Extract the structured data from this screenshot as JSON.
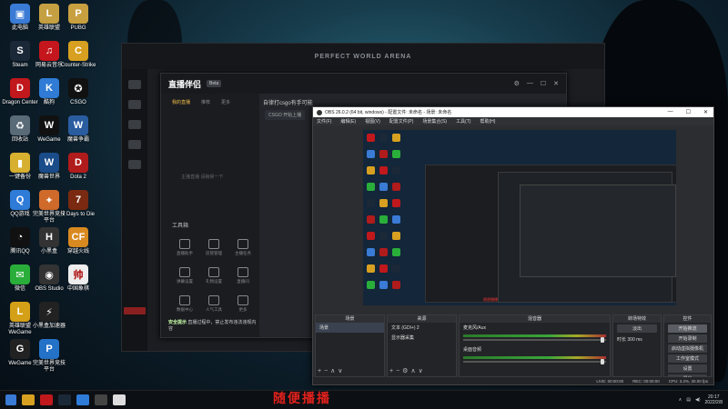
{
  "desktop_icons": [
    {
      "label": "此电脑",
      "color": "#3a7bd5",
      "glyph": "▣"
    },
    {
      "label": "Steam",
      "color": "#1b2838",
      "glyph": "S"
    },
    {
      "label": "Dragon Center",
      "color": "#c0181c",
      "glyph": "D"
    },
    {
      "label": "回收站",
      "color": "#5a6b78",
      "glyph": "♻"
    },
    {
      "label": "一键备份",
      "color": "#d8b030",
      "glyph": "▮"
    },
    {
      "label": "QQ游戏",
      "color": "#2e7bd8",
      "glyph": "Q"
    },
    {
      "label": "腾讯QQ",
      "color": "#111",
      "glyph": "◔"
    },
    {
      "label": "微信",
      "color": "#2aae3a",
      "glyph": "✉"
    },
    {
      "label": "英雄联盟 WeGame",
      "color": "#d4a017",
      "glyph": "L"
    },
    {
      "label": "WeGame",
      "color": "#222",
      "glyph": "G"
    },
    {
      "label": "英雄联盟",
      "color": "#c5a042",
      "glyph": "L"
    },
    {
      "label": "网易云音乐",
      "color": "#c4161c",
      "glyph": "♫"
    },
    {
      "label": "酷狗",
      "color": "#2f7bd6",
      "glyph": "K"
    },
    {
      "label": "WeGame",
      "color": "#111",
      "glyph": "W"
    },
    {
      "label": "魔兽世界",
      "color": "#1a4c8a",
      "glyph": "W"
    },
    {
      "label": "完美世界竞技平台",
      "color": "#d06a2a",
      "glyph": "✦"
    },
    {
      "label": "小黑盒",
      "color": "#333",
      "glyph": "H"
    },
    {
      "label": "OBS Studio",
      "color": "#333",
      "glyph": "◉"
    },
    {
      "label": "小黑盒加速器",
      "color": "#222",
      "glyph": "⚡"
    },
    {
      "label": "完美世界竞技平台",
      "color": "#2471c8",
      "glyph": "P"
    },
    {
      "label": "PUBG",
      "color": "#c8a040",
      "glyph": "P"
    },
    {
      "label": "Counter-Strike",
      "color": "#d8a020",
      "glyph": "C"
    },
    {
      "label": "CSGO",
      "color": "#111",
      "glyph": "✪"
    },
    {
      "label": "魔兽争霸",
      "color": "#2a5ca0",
      "glyph": "W"
    },
    {
      "label": "Dota 2",
      "color": "#b01b1b",
      "glyph": "D"
    },
    {
      "label": "7 Days to Die",
      "color": "#7a2a10",
      "glyph": "7"
    },
    {
      "label": "穿越火线",
      "color": "#d88a20",
      "glyph": "CF"
    },
    {
      "label": "中国象棋",
      "color": "#eee",
      "glyph": "帅"
    }
  ],
  "client": {
    "brand": "PERFECT WORLD ARENA"
  },
  "companion": {
    "logo": "直播伴侣",
    "version": "Beta",
    "tabs": [
      "我的直播",
      "推荐",
      "更多"
    ],
    "game_title": "自律打csgo有手可能",
    "category": "CSGO",
    "category_btn": "开始上播",
    "center_text": "主播直播 请稍候一下",
    "toolbox": "工具箱",
    "tools": [
      "直播助手",
      "房管管理",
      "主播任务",
      "弹幕设置",
      "礼物设置",
      "直播间",
      "数据中心",
      "人气工具",
      "更多"
    ],
    "notice_prefix": "安全提示",
    "notice": "直播过程中，禁止发布违法违规内容"
  },
  "obs": {
    "title": "OBS 26.0.2 (64 bit, windows) - 配置文件: 未命名 - 场景: 未命名",
    "menu": [
      "文件(F)",
      "编辑(E)",
      "视图(V)",
      "配置文件(P)",
      "场景集合(S)",
      "工具(T)",
      "帮助(H)"
    ],
    "preview_label": "随便播播",
    "docks": {
      "scenes": {
        "header": "场景",
        "items": [
          "场景"
        ]
      },
      "sources": {
        "header": "来源",
        "items": [
          "文本 (GDI+) 2",
          "显示器采集"
        ]
      },
      "mixer": {
        "header": "混音器",
        "channels": [
          {
            "name": "麦克风/Aux",
            "level": "0.0 dB"
          },
          {
            "name": "桌面音频",
            "level": "0.0 dB"
          }
        ]
      },
      "transitions": {
        "header": "转场特效",
        "type": "淡出",
        "duration_label": "时长",
        "duration": "300 ms"
      },
      "controls": {
        "header": "控件",
        "buttons": [
          "开始推流",
          "开始录制",
          "启动虚拟摄像机",
          "工作室模式",
          "设置",
          "退出"
        ]
      }
    },
    "status": {
      "live": "LIVE: 00:00:00",
      "rec": "REC: 00:00:00",
      "cpu": "CPU: 3.2%, 30.00 fps"
    }
  },
  "taskbar": {
    "subtitle": "随便播播",
    "time": "20:17",
    "date": "2022/2/8"
  }
}
